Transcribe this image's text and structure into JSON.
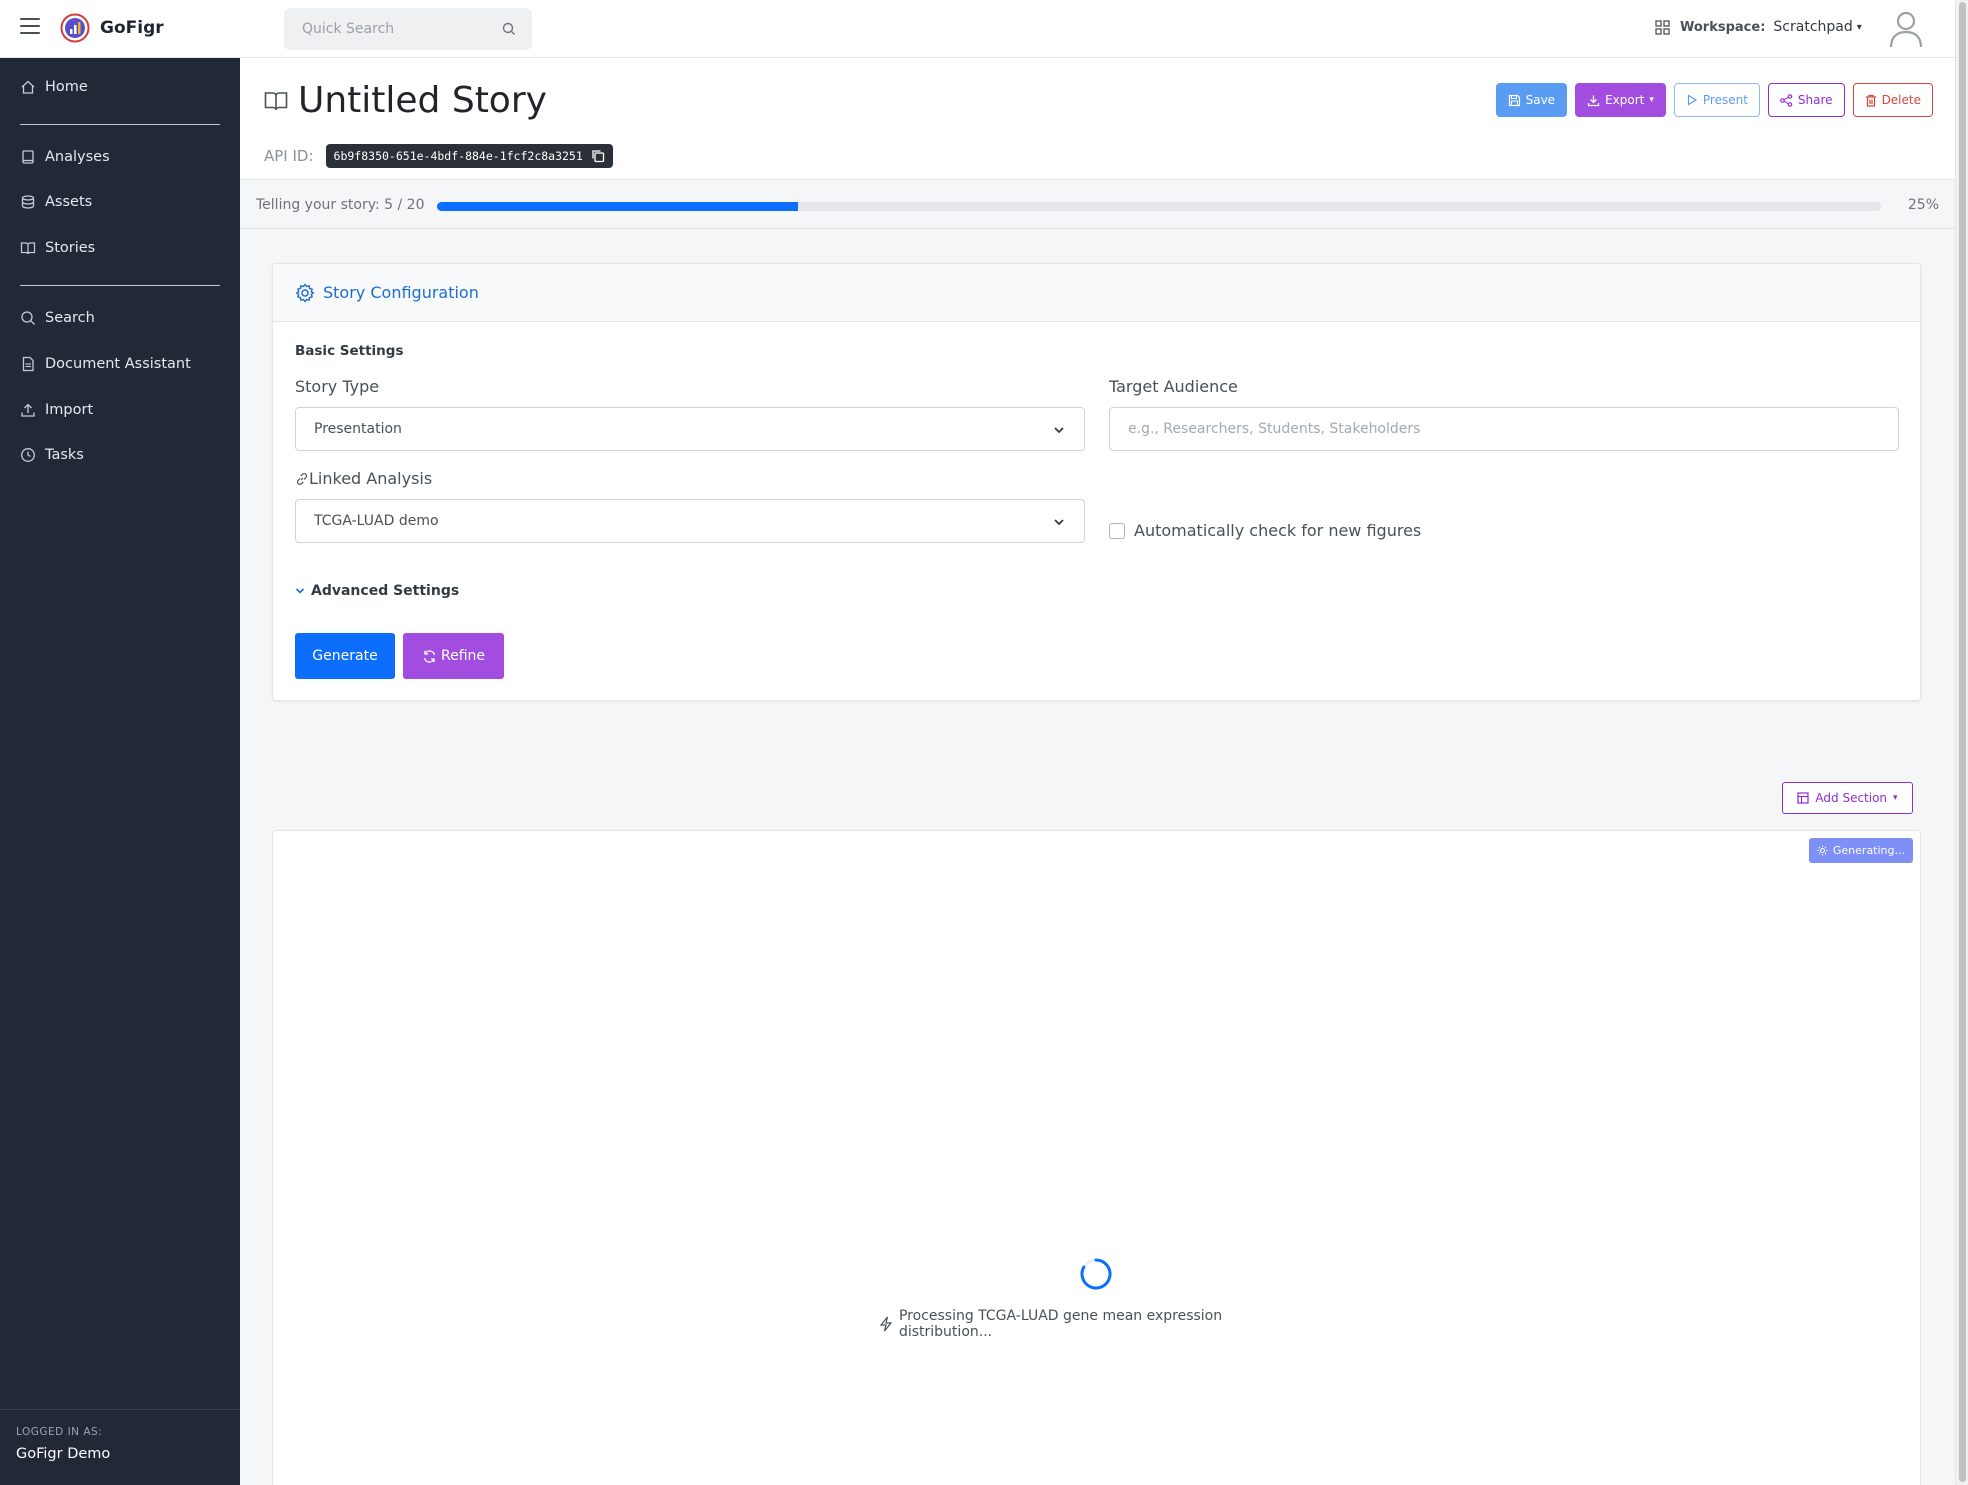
{
  "app": {
    "name": "GoFigr"
  },
  "search": {
    "placeholder": "Quick Search"
  },
  "workspace": {
    "label": "Workspace:",
    "value": "Scratchpad"
  },
  "sidebar": {
    "items": [
      {
        "label": "Home",
        "icon": "home-icon"
      },
      {
        "label": "Analyses",
        "icon": "book-icon"
      },
      {
        "label": "Assets",
        "icon": "database-icon"
      },
      {
        "label": "Stories",
        "icon": "open-book-icon"
      },
      {
        "label": "Search",
        "icon": "search-icon"
      },
      {
        "label": "Document Assistant",
        "icon": "document-icon"
      },
      {
        "label": "Import",
        "icon": "upload-icon"
      },
      {
        "label": "Tasks",
        "icon": "clock-icon"
      }
    ],
    "logged_in_caption": "LOGGED IN AS:",
    "user": "GoFigr Demo"
  },
  "header": {
    "title": "Untitled Story",
    "api_label": "API ID:",
    "api_id": "6b9f8350-651e-4bdf-884e-1fcf2c8a3251",
    "actions": {
      "save": "Save",
      "export": "Export",
      "present": "Present",
      "share": "Share",
      "delete": "Delete"
    }
  },
  "progress": {
    "label": "Telling your story: 5 / 20",
    "percent_text": "25%",
    "value": 0.25
  },
  "config": {
    "title": "Story Configuration",
    "basic_settings": "Basic Settings",
    "story_type_label": "Story Type",
    "story_type_value": "Presentation",
    "target_audience_label": "Target Audience",
    "target_audience_placeholder": "e.g., Researchers, Students, Stakeholders",
    "linked_analysis_label": "Linked Analysis",
    "linked_analysis_value": "TCGA-LUAD demo",
    "auto_check_label": "Automatically check for new figures",
    "advanced_settings": "Advanced Settings",
    "generate": "Generate",
    "refine": "Refine"
  },
  "story": {
    "add_section": "Add Section",
    "generating_badge": "Generating...",
    "processing_text": "Processing TCGA-LUAD gene mean expression distribution..."
  },
  "colors": {
    "sidebar_bg": "#212937",
    "primary": "#0d6efd",
    "purple": "#a34de0",
    "danger": "#d6453d"
  }
}
